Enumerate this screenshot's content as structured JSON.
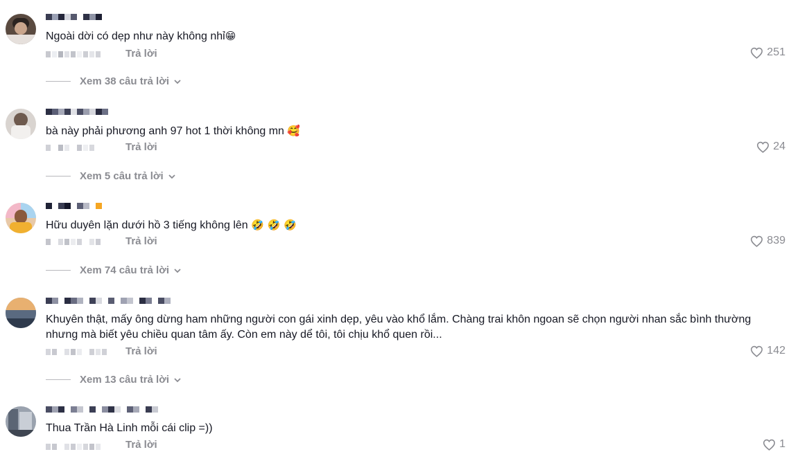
{
  "reply_label": "Trả lời",
  "comments": [
    {
      "text": "Ngoài dời có dẹp như này không nhỉ",
      "emoji": "😁",
      "likes": "251",
      "view_replies": "Xem 38 câu trả lời"
    },
    {
      "text": "bà này phải phương anh 97 hot 1 thời không mn ",
      "emoji": "🥰",
      "likes": "24",
      "view_replies": "Xem 5 câu trả lời"
    },
    {
      "text": "Hữu duyên lặn dưới hồ 3 tiếng không lên ",
      "emoji": "🤣 🤣 🤣",
      "likes": "839",
      "view_replies": "Xem 74 câu trả lời"
    },
    {
      "text": "Khuyên thật, mấy ông dừng ham những người con gái xinh dẹp, yêu vào khổ lắm. Chàng trai khôn ngoan sẽ chọn người nhan sắc bình thường nhưng mà biết yêu chiều quan tâm ấy. Còn em này dể tôi, tôi chịu khổ quen rồi...",
      "emoji": "",
      "likes": "142",
      "view_replies": "Xem 13 câu trả lời"
    },
    {
      "text": "Thua Trần Hà Linh mỗi cái clip =))",
      "emoji": "",
      "likes": "1",
      "view_replies": ""
    }
  ],
  "icons": {
    "like": "heart-outline-icon",
    "expand": "chevron-down-icon"
  },
  "colors": {
    "text": "#161823",
    "muted": "#8a8b91"
  }
}
